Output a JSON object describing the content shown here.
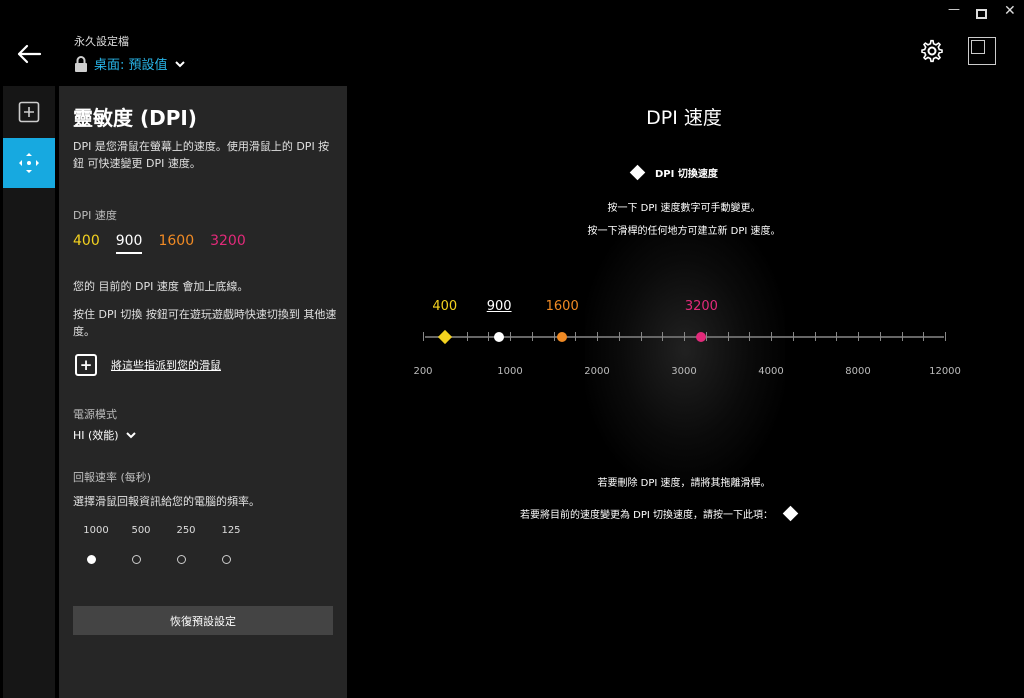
{
  "window": {
    "minimize": "—",
    "close": "✕"
  },
  "header": {
    "profile_caption": "永久設定檔",
    "profile_name": "桌面: 預設值"
  },
  "panel": {
    "title": "靈敏度 (DPI)",
    "description": "DPI 是您滑鼠在螢幕上的速度。使用滑鼠上的 DPI 按鈕 可快速變更 DPI 速度。",
    "dpi_label": "DPI 速度",
    "dpi_values": [
      "400",
      "900",
      "1600",
      "3200"
    ],
    "note_current": "您的 目前的 DPI 速度 會加上底線。",
    "note_shift": "按住 DPI 切換 按鈕可在遊玩遊戲時快速切換到 其他速度。",
    "assign_label": "將這些指派到您的滑鼠",
    "power_label": "電源模式",
    "power_value": "HI (效能)",
    "rate_label": "回報速率 (每秒)",
    "rate_desc": "選擇滑鼠回報資訊給您的電腦的頻率。",
    "rate_options": [
      "1000",
      "500",
      "250",
      "125"
    ],
    "rate_selected": "1000",
    "reset_label": "恢復預設設定"
  },
  "main": {
    "title": "DPI 速度",
    "shift_label": "DPI 切換速度",
    "instruction_1": "按一下 DPI 速度數字可手動變更。",
    "instruction_2": "按一下滑桿的任何地方可建立新 DPI 速度。",
    "delete_note": "若要刪除 DPI 速度，請將其拖離滑桿。",
    "make_shift_note": "若要將目前的速度變更為 DPI 切換速度，請按一下此項："
  },
  "slider": {
    "min": 200,
    "max": 12000,
    "axis_labels": [
      "200",
      "1000",
      "2000",
      "3000",
      "4000",
      "8000",
      "12000"
    ],
    "markers": [
      {
        "label": "400",
        "value": 400,
        "color": "#f4d21f",
        "shape": "diamond",
        "current": false
      },
      {
        "label": "900",
        "value": 900,
        "color": "#ffffff",
        "shape": "circle",
        "current": true
      },
      {
        "label": "1600",
        "value": 1600,
        "color": "#f08a24",
        "shape": "circle",
        "current": false
      },
      {
        "label": "3200",
        "value": 3200,
        "color": "#e22a7a",
        "shape": "circle",
        "current": false
      }
    ]
  },
  "colors": {
    "accent": "#17a9e0",
    "profile_text": "#29b6e9",
    "dpi_1": "#f4d21f",
    "dpi_2": "#ffffff",
    "dpi_3": "#f08a24",
    "dpi_4": "#e22a7a"
  }
}
